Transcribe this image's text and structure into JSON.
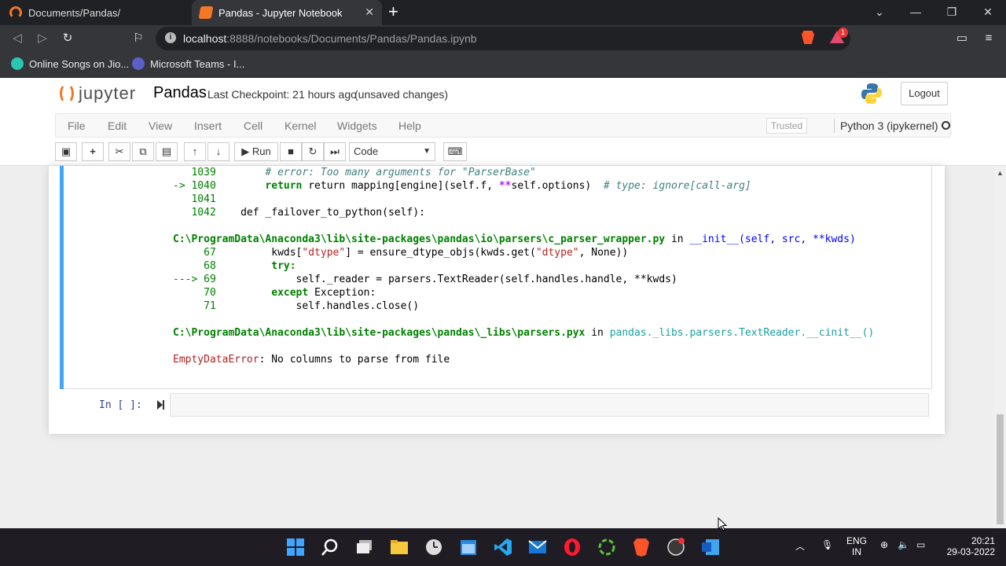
{
  "browser": {
    "tabs": [
      {
        "label": "Documents/Pandas/"
      },
      {
        "label": "Pandas - Jupyter Notebook"
      }
    ],
    "new_tab": "+",
    "url_host": "localhost",
    "url_path": ":8888/notebooks/Documents/Pandas/Pandas.ipynb",
    "shields_badge": "1",
    "bookmarks": [
      {
        "label": "Online Songs on Jio..."
      },
      {
        "label": "Microsoft Teams - I..."
      }
    ]
  },
  "jupyter": {
    "logo_text": "jupyter",
    "notebook_name": "Pandas",
    "checkpoint": "Last Checkpoint: 21 hours ago",
    "unsaved": "(unsaved changes)",
    "logout_label": "Logout",
    "menus": [
      "File",
      "Edit",
      "View",
      "Insert",
      "Cell",
      "Kernel",
      "Widgets",
      "Help"
    ],
    "trusted": "Trusted",
    "kernel": "Python 3 (ipykernel)",
    "run_label": "Run",
    "cell_type": "Code"
  },
  "traceback": {
    "l1_num": "1039",
    "l1_code": "# error: Too many arguments for \"ParserBase\"",
    "l2_arrow": "-> 1040",
    "l2_a": "return mapping[engine](self.f, ",
    "l2_b": "**",
    "l2_c": "self.options)  ",
    "l2_d": "# type: ignore[call-arg]",
    "l3_num": "1041",
    "l4_num": "1042",
    "l4_code": "def _failover_to_python(self):",
    "file1": "C:\\ProgramData\\Anaconda3\\lib\\site-packages\\pandas\\io\\parsers\\c_parser_wrapper.py",
    "in1": " in ",
    "fn1": "__init__(self, src, **kwds)",
    "l5_num": "67",
    "l5_a": "kwds[",
    "l5_b": "\"dtype\"",
    "l5_c": "] = ensure_dtype_objs(kwds.get(",
    "l5_d": "\"dtype\"",
    "l5_e": ", None))",
    "l6_num": "68",
    "l6_code": "try:",
    "l7_arrow": "---> 69",
    "l7_code": "self._reader = parsers.TextReader(self.handles.handle, **kwds)",
    "l8_num": "70",
    "l8_a": "except",
    "l8_b": " Exception:",
    "l9_num": "71",
    "l9_code": "self.handles.close()",
    "file2": "C:\\ProgramData\\Anaconda3\\lib\\site-packages\\pandas\\_libs\\parsers.pyx",
    "in2": " in ",
    "fn2": "pandas._libs.parsers.TextReader.__cinit__()",
    "err_name": "EmptyDataError",
    "err_msg": ": No columns to parse from file"
  },
  "input_prompt": "In [ ]:",
  "taskbar": {
    "lang_1": "ENG",
    "lang_2": "IN",
    "time": "20:21",
    "date": "29-03-2022"
  }
}
